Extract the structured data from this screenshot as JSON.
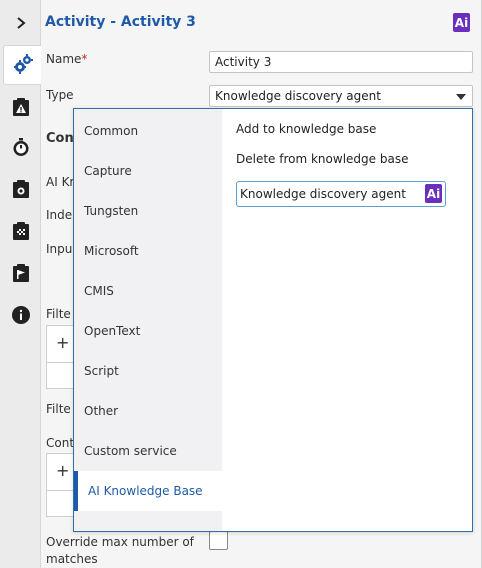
{
  "header": {
    "title": "Activity  - Activity 3",
    "ai_badge": "Ai"
  },
  "rail": {
    "icons": [
      "chevron-right-icon",
      "gears-icon",
      "warning-clipboard-icon",
      "stopwatch-icon",
      "camera-clipboard-icon",
      "flag-clipboard-icon",
      "flag-board-icon",
      "info-icon"
    ]
  },
  "form": {
    "name_label": "Name",
    "name_required_mark": "*",
    "name_value": "Activity 3",
    "type_label": "Type",
    "type_value": "Knowledge discovery agent",
    "section_heading_partial": "Con",
    "ai_kr_partial": "AI Kr",
    "index_partial": "Inde",
    "input_partial": "Inpu",
    "filter_partial": "Filte",
    "filter2_partial": "Filte",
    "cont_partial": "Cont",
    "plus": "+",
    "override_label_line1": "Override max number of",
    "override_label_line2": "matches"
  },
  "dropdown": {
    "categories": [
      "Common",
      "Capture",
      "Tungsten",
      "Microsoft",
      "CMIS",
      "OpenText",
      "Script",
      "Other",
      "Custom service",
      "AI Knowledge Base"
    ],
    "active_category": "AI Knowledge Base",
    "options": [
      "Add to knowledge base",
      "Delete from knowledge base",
      "Knowledge discovery agent"
    ],
    "selected_option": "Knowledge discovery agent",
    "option_badge": "Ai"
  },
  "colors": {
    "accent": "#1e5aa8",
    "ai_purple": "#6b2fbd",
    "selection_border": "#5aa2d6",
    "required": "#c62828"
  }
}
